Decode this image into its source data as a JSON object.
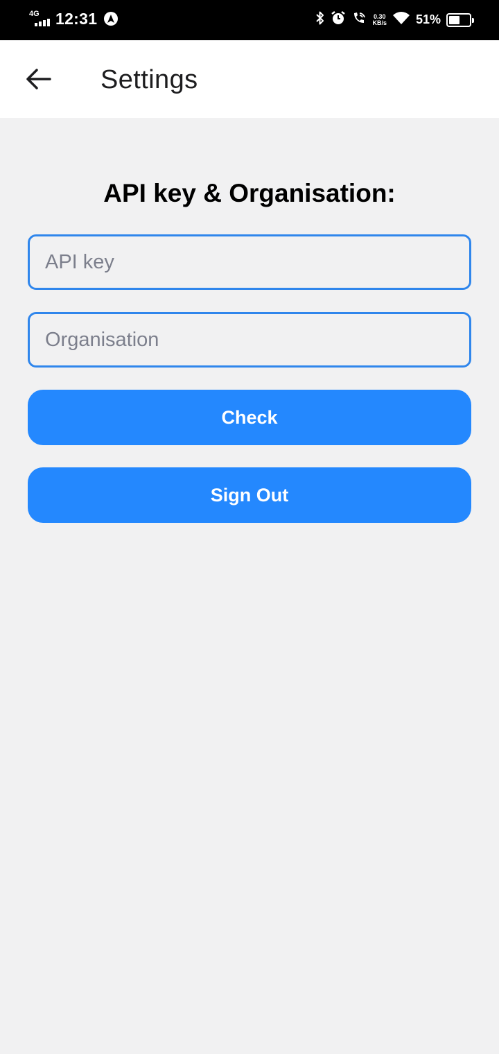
{
  "status_bar": {
    "network": "4G",
    "time": "12:31",
    "speed_value": "0.30",
    "speed_unit": "KB/s",
    "battery_percent": "51%",
    "battery_level": 0.51
  },
  "app_bar": {
    "back_icon": "arrow-left-icon",
    "title": "Settings"
  },
  "content": {
    "heading": "API key & Organisation:",
    "api_key_placeholder": "API key",
    "organisation_placeholder": "Organisation",
    "check_label": "Check",
    "sign_out_label": "Sign Out"
  },
  "colors": {
    "accent": "#2488fe",
    "field_border": "#2f86ec",
    "background": "#f1f1f2"
  }
}
